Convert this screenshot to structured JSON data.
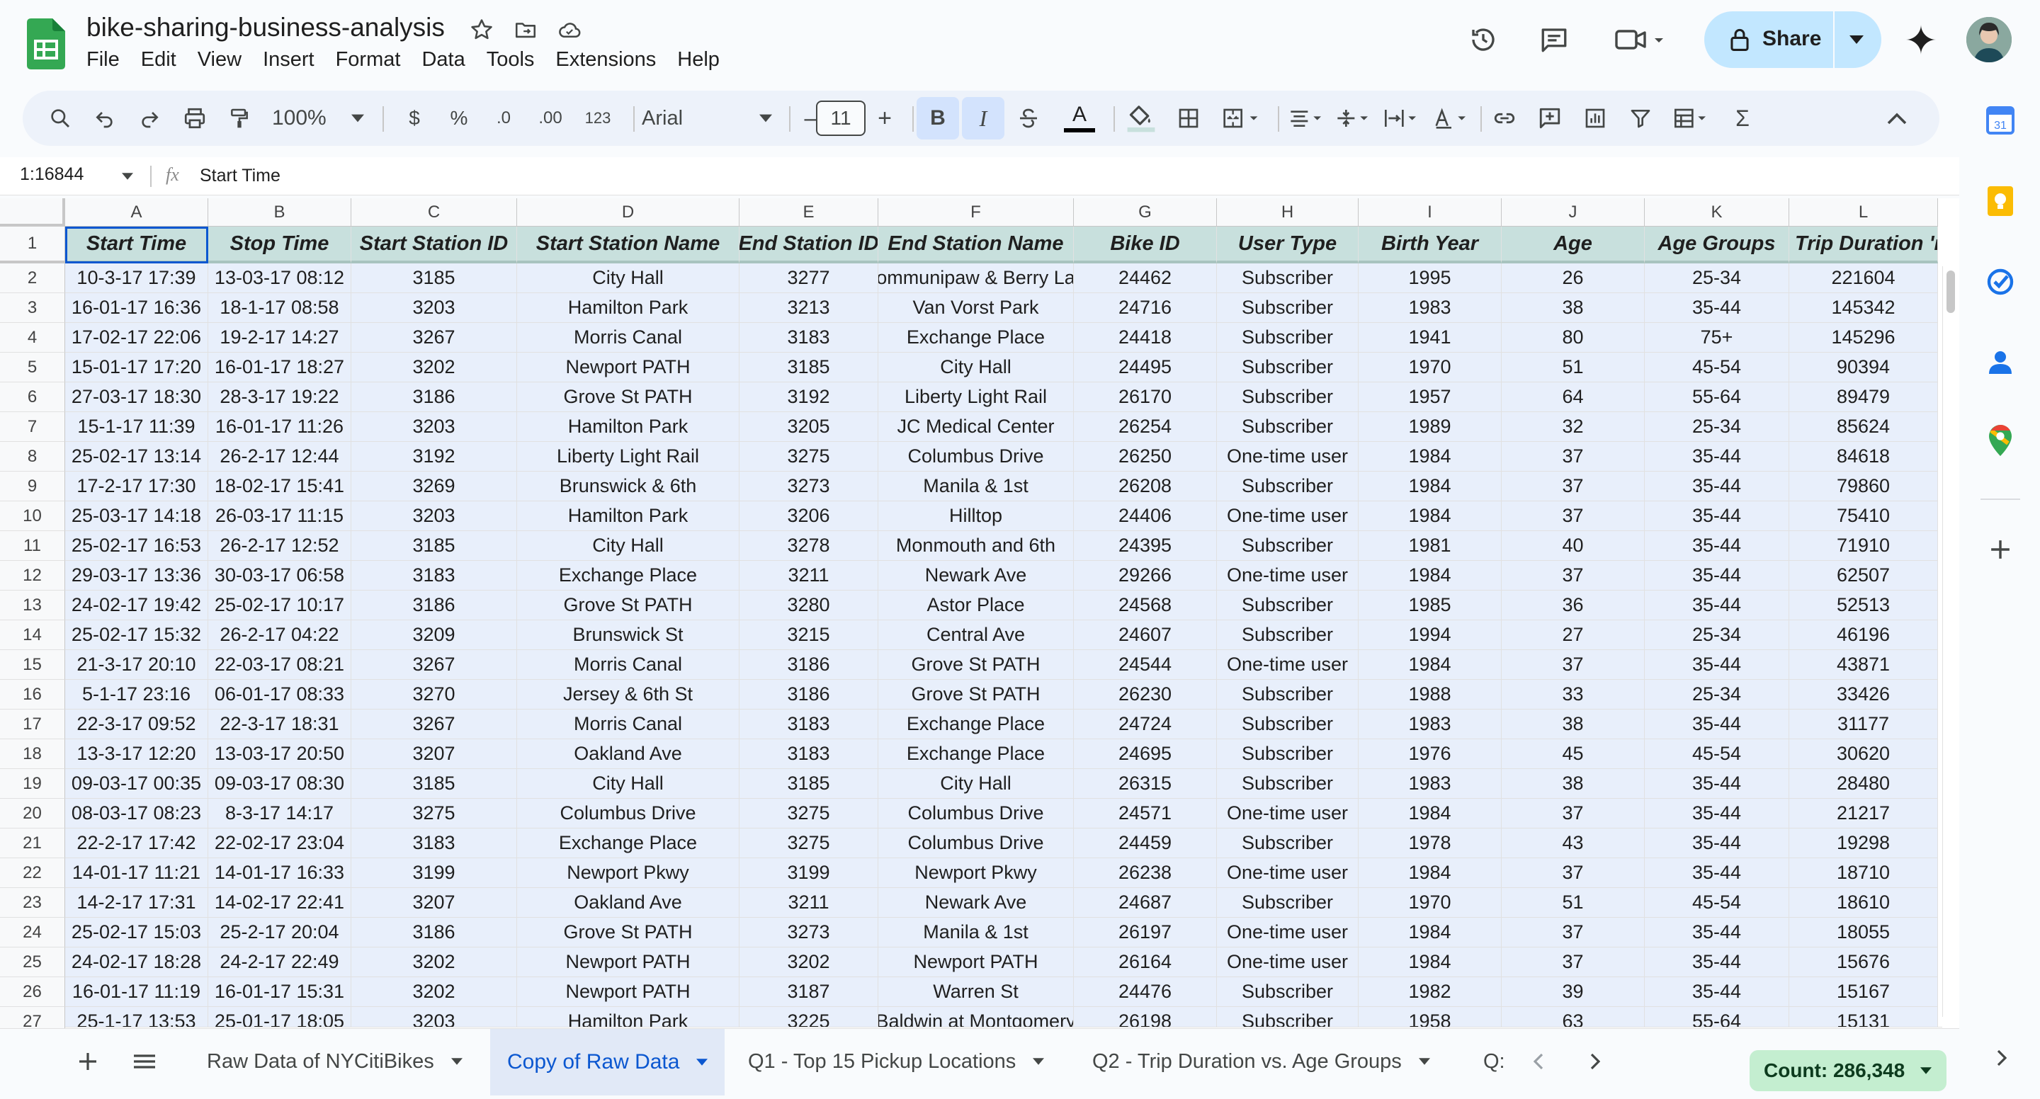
{
  "window": {
    "doc_title": "bike-sharing-business-analysis",
    "menu": [
      "File",
      "Edit",
      "View",
      "Insert",
      "Format",
      "Data",
      "Tools",
      "Extensions",
      "Help"
    ],
    "share_label": "Share"
  },
  "toolbar": {
    "zoom": "100%",
    "currency": "$",
    "percent": "%",
    "decrease_decimal": ".0",
    "increase_decimal": ".00",
    "number_format": "123",
    "font": "Arial",
    "font_size": "11",
    "minus": "–",
    "plus": "+",
    "bold": "B",
    "italic": "I",
    "text_color_letter": "A",
    "sum": "Σ"
  },
  "formula_bar": {
    "name_box": "1:16844",
    "fx": "fx",
    "content": "Start Time"
  },
  "columns": [
    "A",
    "B",
    "C",
    "D",
    "E",
    "F",
    "G",
    "H",
    "I",
    "J",
    "K",
    "L"
  ],
  "header_row": [
    "Start Time",
    "Stop Time",
    "Start Station ID",
    "Start Station Name",
    "End Station ID",
    "End Station Name",
    "Bike ID",
    "User Type",
    "Birth Year",
    "Age",
    "Age Groups",
    "Trip Duration 'n"
  ],
  "rows": [
    {
      "n": "2",
      "c": [
        "10-3-17 17:39",
        "13-03-17 08:12",
        "3185",
        "City Hall",
        "3277",
        "ommunipaw & Berry La",
        "24462",
        "Subscriber",
        "1995",
        "26",
        "25-34",
        "221604"
      ]
    },
    {
      "n": "3",
      "c": [
        "16-01-17 16:36",
        "18-1-17 08:58",
        "3203",
        "Hamilton Park",
        "3213",
        "Van Vorst Park",
        "24716",
        "Subscriber",
        "1983",
        "38",
        "35-44",
        "145342"
      ]
    },
    {
      "n": "4",
      "c": [
        "17-02-17 22:06",
        "19-2-17 14:27",
        "3267",
        "Morris Canal",
        "3183",
        "Exchange Place",
        "24418",
        "Subscriber",
        "1941",
        "80",
        "75+",
        "145296"
      ]
    },
    {
      "n": "5",
      "c": [
        "15-01-17 17:20",
        "16-01-17 18:27",
        "3202",
        "Newport PATH",
        "3185",
        "City Hall",
        "24495",
        "Subscriber",
        "1970",
        "51",
        "45-54",
        "90394"
      ]
    },
    {
      "n": "6",
      "c": [
        "27-03-17 18:30",
        "28-3-17 19:22",
        "3186",
        "Grove St PATH",
        "3192",
        "Liberty Light Rail",
        "26170",
        "Subscriber",
        "1957",
        "64",
        "55-64",
        "89479"
      ]
    },
    {
      "n": "7",
      "c": [
        "15-1-17 11:39",
        "16-01-17 11:26",
        "3203",
        "Hamilton Park",
        "3205",
        "JC Medical Center",
        "26254",
        "Subscriber",
        "1989",
        "32",
        "25-34",
        "85624"
      ]
    },
    {
      "n": "8",
      "c": [
        "25-02-17 13:14",
        "26-2-17 12:44",
        "3192",
        "Liberty Light Rail",
        "3275",
        "Columbus Drive",
        "26250",
        "One-time user",
        "1984",
        "37",
        "35-44",
        "84618"
      ]
    },
    {
      "n": "9",
      "c": [
        "17-2-17 17:30",
        "18-02-17 15:41",
        "3269",
        "Brunswick & 6th",
        "3273",
        "Manila & 1st",
        "26208",
        "Subscriber",
        "1984",
        "37",
        "35-44",
        "79860"
      ]
    },
    {
      "n": "10",
      "c": [
        "25-03-17 14:18",
        "26-03-17 11:15",
        "3203",
        "Hamilton Park",
        "3206",
        "Hilltop",
        "24406",
        "One-time user",
        "1984",
        "37",
        "35-44",
        "75410"
      ]
    },
    {
      "n": "11",
      "c": [
        "25-02-17 16:53",
        "26-2-17 12:52",
        "3185",
        "City Hall",
        "3278",
        "Monmouth and 6th",
        "24395",
        "Subscriber",
        "1981",
        "40",
        "35-44",
        "71910"
      ]
    },
    {
      "n": "12",
      "c": [
        "29-03-17 13:36",
        "30-03-17 06:58",
        "3183",
        "Exchange Place",
        "3211",
        "Newark Ave",
        "29266",
        "One-time user",
        "1984",
        "37",
        "35-44",
        "62507"
      ]
    },
    {
      "n": "13",
      "c": [
        "24-02-17 19:42",
        "25-02-17 10:17",
        "3186",
        "Grove St PATH",
        "3280",
        "Astor Place",
        "24568",
        "Subscriber",
        "1985",
        "36",
        "35-44",
        "52513"
      ]
    },
    {
      "n": "14",
      "c": [
        "25-02-17 15:32",
        "26-2-17 04:22",
        "3209",
        "Brunswick St",
        "3215",
        "Central Ave",
        "24607",
        "Subscriber",
        "1994",
        "27",
        "25-34",
        "46196"
      ]
    },
    {
      "n": "15",
      "c": [
        "21-3-17 20:10",
        "22-03-17 08:21",
        "3267",
        "Morris Canal",
        "3186",
        "Grove St PATH",
        "24544",
        "One-time user",
        "1984",
        "37",
        "35-44",
        "43871"
      ]
    },
    {
      "n": "16",
      "c": [
        "5-1-17 23:16",
        "06-01-17 08:33",
        "3270",
        "Jersey & 6th St",
        "3186",
        "Grove St PATH",
        "26230",
        "Subscriber",
        "1988",
        "33",
        "25-34",
        "33426"
      ]
    },
    {
      "n": "17",
      "c": [
        "22-3-17 09:52",
        "22-3-17 18:31",
        "3267",
        "Morris Canal",
        "3183",
        "Exchange Place",
        "24724",
        "Subscriber",
        "1983",
        "38",
        "35-44",
        "31177"
      ]
    },
    {
      "n": "18",
      "c": [
        "13-3-17 12:20",
        "13-03-17 20:50",
        "3207",
        "Oakland Ave",
        "3183",
        "Exchange Place",
        "24695",
        "Subscriber",
        "1976",
        "45",
        "45-54",
        "30620"
      ]
    },
    {
      "n": "19",
      "c": [
        "09-03-17 00:35",
        "09-03-17 08:30",
        "3185",
        "City Hall",
        "3185",
        "City Hall",
        "26315",
        "Subscriber",
        "1983",
        "38",
        "35-44",
        "28480"
      ]
    },
    {
      "n": "20",
      "c": [
        "08-03-17 08:23",
        "8-3-17 14:17",
        "3275",
        "Columbus Drive",
        "3275",
        "Columbus Drive",
        "24571",
        "One-time user",
        "1984",
        "37",
        "35-44",
        "21217"
      ]
    },
    {
      "n": "21",
      "c": [
        "22-2-17 17:42",
        "22-02-17 23:04",
        "3183",
        "Exchange Place",
        "3275",
        "Columbus Drive",
        "24459",
        "Subscriber",
        "1978",
        "43",
        "35-44",
        "19298"
      ]
    },
    {
      "n": "22",
      "c": [
        "14-01-17 11:21",
        "14-01-17 16:33",
        "3199",
        "Newport Pkwy",
        "3199",
        "Newport Pkwy",
        "26238",
        "One-time user",
        "1984",
        "37",
        "35-44",
        "18710"
      ]
    },
    {
      "n": "23",
      "c": [
        "14-2-17 17:31",
        "14-02-17 22:41",
        "3207",
        "Oakland Ave",
        "3211",
        "Newark Ave",
        "24687",
        "Subscriber",
        "1970",
        "51",
        "45-54",
        "18610"
      ]
    },
    {
      "n": "24",
      "c": [
        "25-02-17 15:03",
        "25-2-17 20:04",
        "3186",
        "Grove St PATH",
        "3273",
        "Manila & 1st",
        "26197",
        "One-time user",
        "1984",
        "37",
        "35-44",
        "18055"
      ]
    },
    {
      "n": "25",
      "c": [
        "24-02-17 18:28",
        "24-2-17 22:49",
        "3202",
        "Newport PATH",
        "3202",
        "Newport PATH",
        "26164",
        "One-time user",
        "1984",
        "37",
        "35-44",
        "15676"
      ]
    },
    {
      "n": "26",
      "c": [
        "16-01-17 11:19",
        "16-01-17 15:31",
        "3202",
        "Newport PATH",
        "3187",
        "Warren St",
        "24476",
        "Subscriber",
        "1982",
        "39",
        "35-44",
        "15167"
      ]
    },
    {
      "n": "27",
      "c": [
        "25-1-17 13:53",
        "25-01-17 18:05",
        "3203",
        "Hamilton Park",
        "3225",
        "Baldwin at Montgomery",
        "26198",
        "Subscriber",
        "1958",
        "63",
        "55-64",
        "15131"
      ]
    }
  ],
  "sheets": {
    "tabs": [
      "Raw Data of NYCitiBikes",
      "Copy of Raw Data",
      "Q1 - Top 15 Pickup Locations",
      "Q2 - Trip Duration vs. Age Groups",
      "Q:"
    ],
    "active_index": 1,
    "count_label": "Count: 286,348"
  },
  "colors": {
    "header_fill": "#c8e0dd",
    "data_fill": "#e8effb",
    "accent": "#0b57d0",
    "share_bg": "#c2e7ff",
    "count_bg": "#c4eed0"
  },
  "icons": [
    "sheets-logo-icon",
    "star-icon",
    "folder-move-icon",
    "cloud-status-icon",
    "history-icon",
    "comment-icon",
    "meet-icon",
    "lock-icon",
    "gemini-icon",
    "avatar",
    "search-icon",
    "undo-icon",
    "redo-icon",
    "print-icon",
    "paint-format-icon",
    "calendar-icon",
    "keep-icon",
    "tasks-icon",
    "contacts-icon",
    "maps-icon"
  ]
}
